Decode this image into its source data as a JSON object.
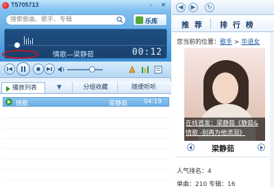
{
  "app": {
    "title": "T5705713",
    "min_btn": "–",
    "close_btn": "✕"
  },
  "search": {
    "placeholder": "搜索歌曲、歌手、专辑",
    "library_label": "乐库"
  },
  "now_playing": {
    "song": "情歌—梁静茹",
    "time": "00:12"
  },
  "controls": {
    "volume_level": 0.7
  },
  "tabs": [
    {
      "label": "播放列表"
    },
    {
      "label": "▼"
    },
    {
      "label": "分组收藏"
    },
    {
      "label": "随便听听"
    }
  ],
  "playlist": [
    {
      "title": "情歌",
      "artist": "梁静茹",
      "duration": "04:19"
    }
  ],
  "browser": {
    "nav_back": "◀",
    "nav_forward": "▶",
    "nav_refresh": "↻",
    "tab_recommend": "推 荐",
    "tab_ranking": "排 行 榜",
    "breadcrumb_prefix": "您当前的位置：",
    "crumb_1": "歌手",
    "crumb_sep": " > ",
    "crumb_2": "华语女",
    "caption_line1": "在线首发：梁静茹《静茹&",
    "caption_line2": "情歌 -别再为他流泪》",
    "artist_name": "梁静茹",
    "popularity": "人气排名：4",
    "singles": "单曲：210   专辑：16"
  },
  "colors": {
    "highlight_ring": "#c0162d",
    "selected_row": "#6aaee6",
    "play_green": "#2a9a2a"
  }
}
